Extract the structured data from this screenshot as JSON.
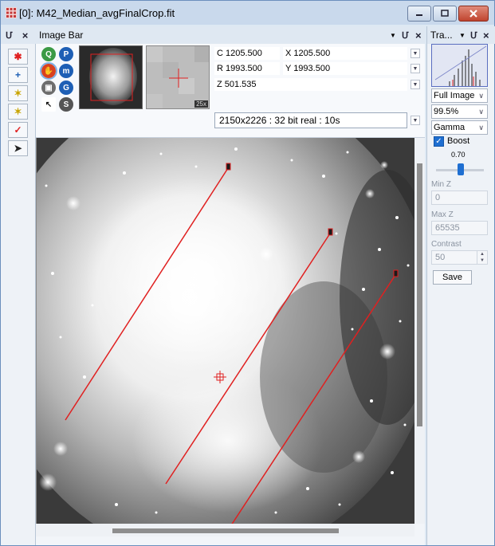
{
  "window": {
    "title": "[0]: M42_Median_avgFinalCrop.fit",
    "icon": "app-grid-icon",
    "controls": [
      "minimize-icon",
      "maximize-icon",
      "close-icon"
    ]
  },
  "left_toolbar": {
    "pin": "Մ",
    "close": "×",
    "tools": [
      {
        "name": "red-star-icon",
        "glyph": "✱"
      },
      {
        "name": "plus-icon",
        "glyph": "+"
      },
      {
        "name": "star-sparkle-icon",
        "glyph": "✶"
      },
      {
        "name": "star-sparkle-red-icon",
        "glyph": "✶"
      },
      {
        "name": "checkmark-icon",
        "glyph": "✓"
      },
      {
        "name": "pointer-star-icon",
        "glyph": "➤"
      }
    ]
  },
  "image_bar": {
    "title": "Image Bar",
    "pin": "Մ",
    "close": "×",
    "nav_buttons": [
      {
        "name": "zoom-magnify-icon",
        "glyph": "Q",
        "color": "#2c8a3a"
      },
      {
        "name": "p-icon",
        "glyph": "P",
        "color": "#1e5fb5"
      },
      {
        "name": "pan-hand-icon",
        "glyph": "✋",
        "color": "#d9411f"
      },
      {
        "name": "m-icon",
        "glyph": "m",
        "color": "#1e5fb5"
      },
      {
        "name": "zoom-box-icon",
        "glyph": "▣",
        "color": "#4d4d4d"
      },
      {
        "name": "g-icon",
        "glyph": "G",
        "color": "#1e5fb5"
      },
      {
        "name": "arrow-cursor-icon",
        "glyph": "↖",
        "color": "#ffffff"
      },
      {
        "name": "circle-s-icon",
        "glyph": "S",
        "color": "#555555"
      }
    ],
    "zoom_badge": "25x",
    "c": "C 1205.500",
    "x": "X 1205.500",
    "r": "R 1993.500",
    "y": "Y 1993.500",
    "z": "Z 501.535",
    "info": "2150x2226 : 32 bit real : 10s"
  },
  "transfer_panel": {
    "title": "Tra...",
    "pin": "Մ",
    "close": "×",
    "region": "Full Image",
    "percent": "99.5%",
    "curve": "Gamma",
    "boost_label": "Boost",
    "boost_checked": true,
    "gamma_value": "0.70",
    "gamma_level": 0.5,
    "min_z_label": "Min Z",
    "min_z": "0",
    "max_z_label": "Max Z",
    "max_z": "65535",
    "contrast_label": "Contrast",
    "contrast": "50",
    "save_label": "Save"
  },
  "colors": {
    "accent": "#1f6fd1",
    "marker": "#e02020",
    "close": "#c0442f"
  }
}
